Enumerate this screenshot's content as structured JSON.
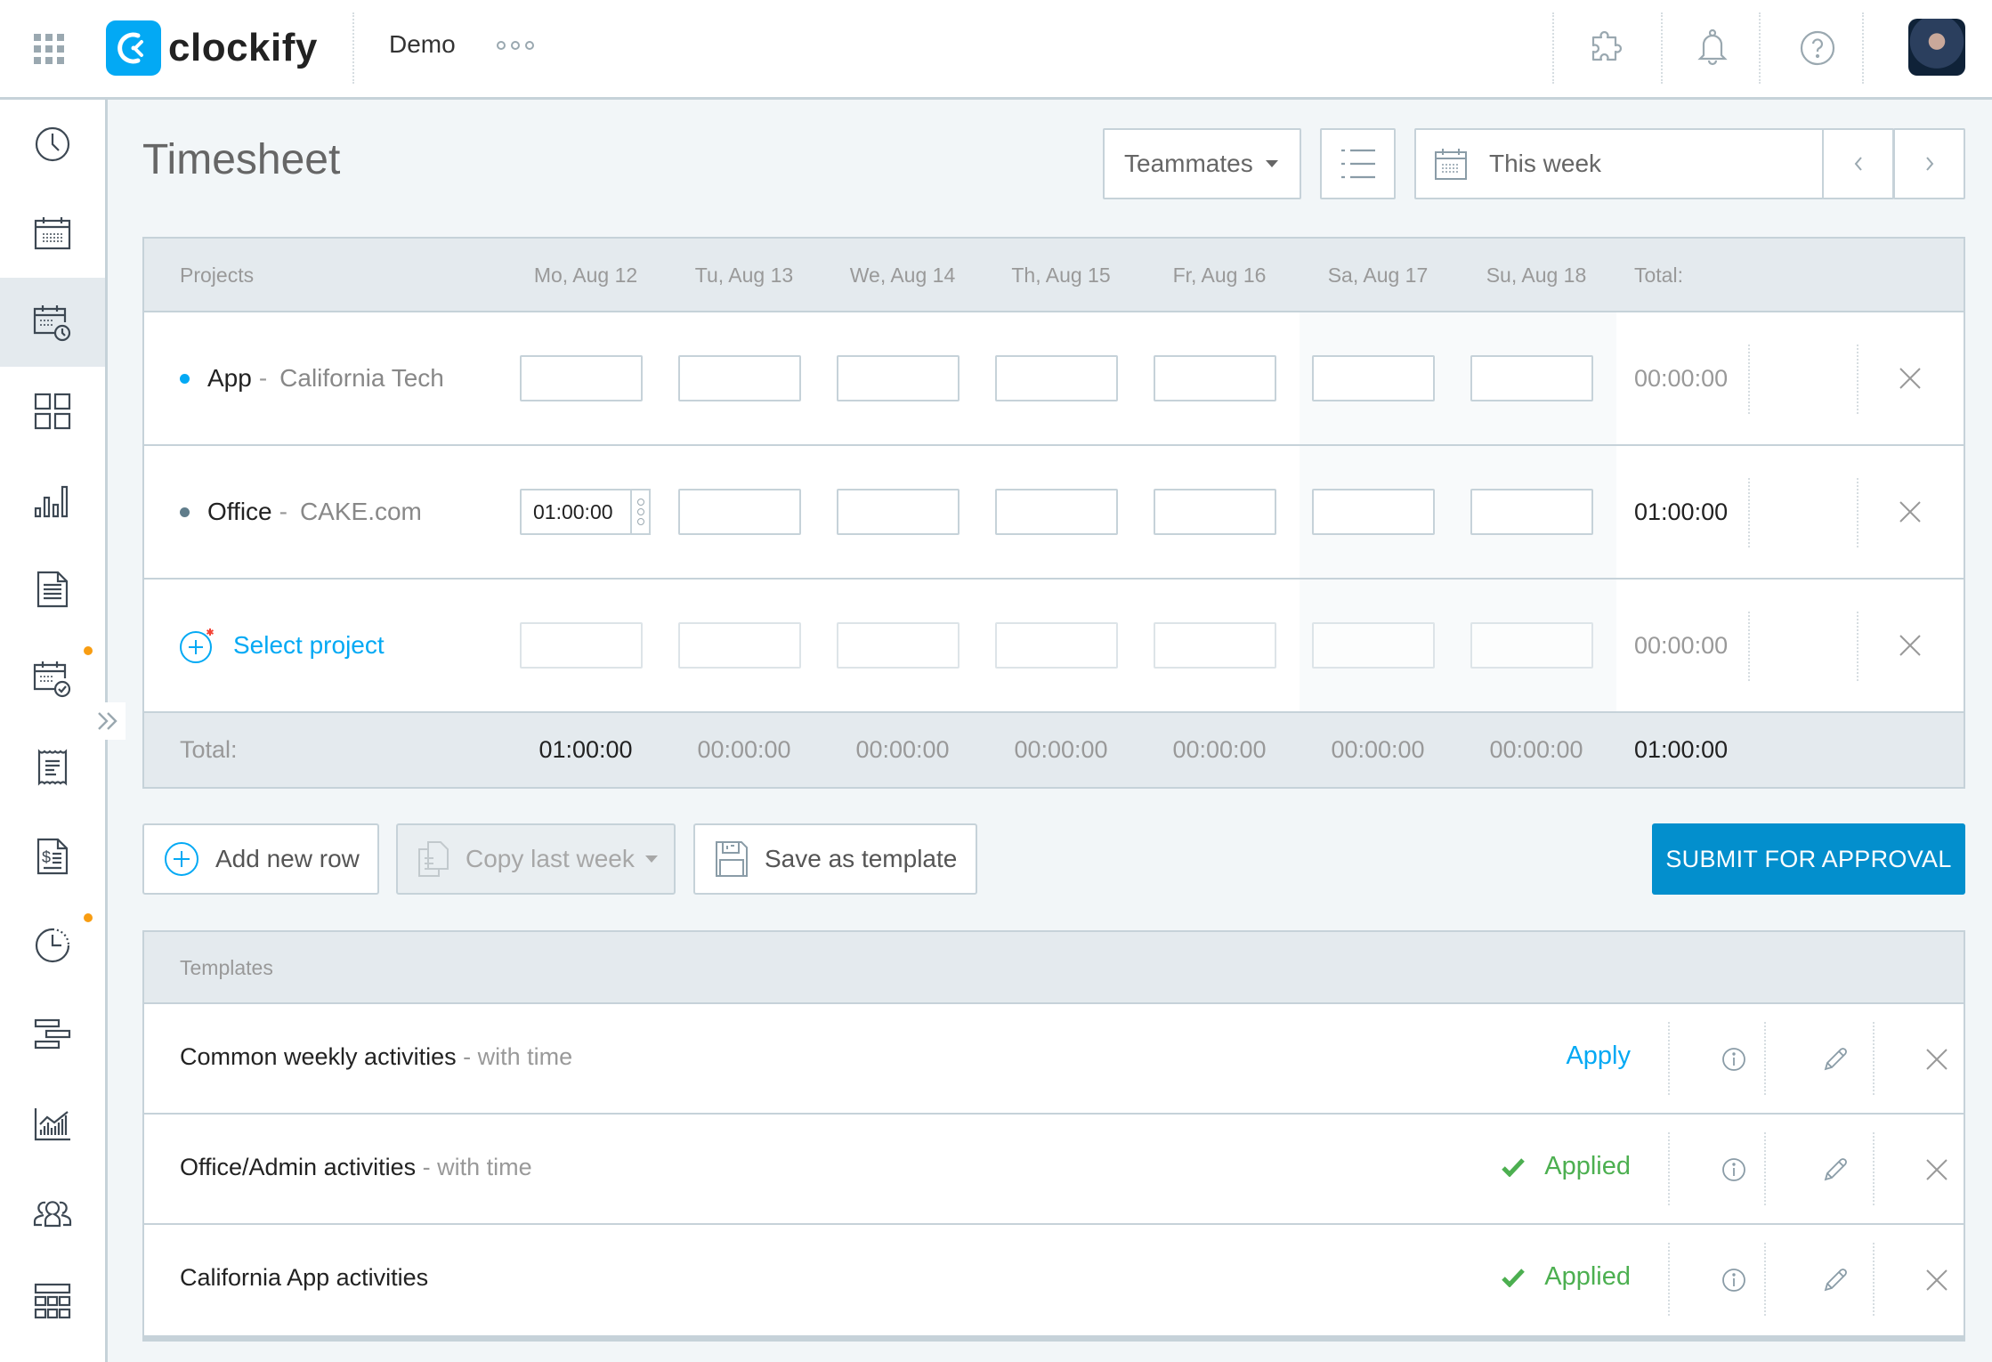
{
  "header": {
    "logo_text": "clockify",
    "workspace": "Demo",
    "icons": [
      "apps-grid-icon",
      "integrations-puzzle-icon",
      "notifications-bell-icon",
      "help-question-icon",
      "user-avatar"
    ]
  },
  "sidebar": {
    "items": [
      {
        "name": "time-tracker",
        "icon": "clock-icon",
        "active": false,
        "dot": false
      },
      {
        "name": "calendar",
        "icon": "calendar-icon",
        "active": false,
        "dot": false
      },
      {
        "name": "timesheet",
        "icon": "calendar-clock-icon",
        "active": true,
        "dot": false
      },
      {
        "name": "dashboard",
        "icon": "dashboard-grid-icon",
        "active": false,
        "dot": false
      },
      {
        "name": "reports",
        "icon": "bar-chart-icon",
        "active": false,
        "dot": false
      },
      {
        "name": "projects",
        "icon": "document-icon",
        "active": false,
        "dot": false
      },
      {
        "name": "approvals",
        "icon": "calendar-check-icon",
        "active": false,
        "dot": true
      },
      {
        "name": "expenses",
        "icon": "receipt-icon",
        "active": false,
        "dot": false
      },
      {
        "name": "invoices",
        "icon": "invoice-dollar-icon",
        "active": false,
        "dot": false
      },
      {
        "name": "time-off",
        "icon": "dotted-clock-icon",
        "active": false,
        "dot": true
      },
      {
        "name": "schedule",
        "icon": "gantt-bars-icon",
        "active": false,
        "dot": false
      },
      {
        "name": "analytics",
        "icon": "area-chart-icon",
        "active": false,
        "dot": false
      },
      {
        "name": "team",
        "icon": "users-icon",
        "active": false,
        "dot": false
      },
      {
        "name": "kiosk",
        "icon": "table-grid-icon",
        "active": false,
        "dot": false
      }
    ],
    "collapse_label": "»"
  },
  "page": {
    "title": "Timesheet",
    "teammates_label": "Teammates",
    "date_range_label": "This week"
  },
  "timesheet": {
    "projects_header": "Projects",
    "total_header": "Total:",
    "days": [
      "Mo, Aug 12",
      "Tu, Aug 13",
      "We, Aug 14",
      "Th, Aug 15",
      "Fr, Aug 16",
      "Sa, Aug 17",
      "Su, Aug 18"
    ],
    "rows": [
      {
        "project": "App",
        "separator": "-",
        "client": "California Tech",
        "color": "#03a9f4",
        "values": [
          "",
          "",
          "",
          "",
          "",
          "",
          ""
        ],
        "total": "00:00:00"
      },
      {
        "project": "Office",
        "separator": "-",
        "client": "CAKE.com",
        "color": "#607d8b",
        "values": [
          "01:00:00",
          "",
          "",
          "",
          "",
          "",
          ""
        ],
        "total": "01:00:00"
      }
    ],
    "select_project_label": "Select project",
    "select_project_total": "00:00:00",
    "totals_label": "Total:",
    "day_totals": [
      "01:00:00",
      "00:00:00",
      "00:00:00",
      "00:00:00",
      "00:00:00",
      "00:00:00",
      "00:00:00"
    ],
    "grand_total": "01:00:00"
  },
  "actions": {
    "add_row": "Add new row",
    "copy_last_week": "Copy last week",
    "save_template": "Save as template",
    "submit": "SUBMIT FOR APPROVAL"
  },
  "templates": {
    "header": "Templates",
    "items": [
      {
        "name": "Common weekly activities",
        "suffix": " - with time",
        "status": "Apply",
        "applied": false
      },
      {
        "name": "Office/Admin activities",
        "suffix": " - with time",
        "status": "Applied",
        "applied": true
      },
      {
        "name": "California App activities",
        "suffix": "",
        "status": "Applied",
        "applied": true
      }
    ]
  },
  "colors": {
    "accent": "#03a9f4",
    "primary_button": "#038fcd",
    "success": "#4caf50",
    "notification_dot": "#f89d12"
  }
}
